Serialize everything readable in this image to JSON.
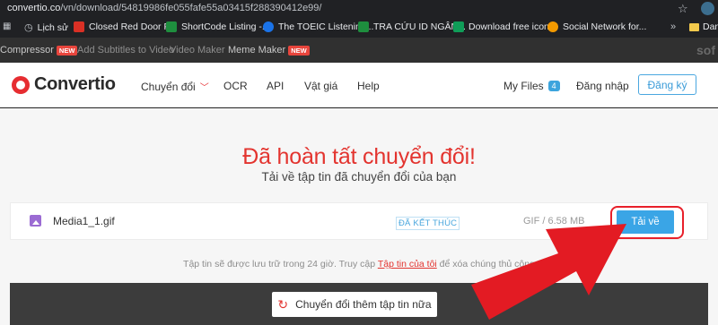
{
  "browser": {
    "url_host": "convertio.co",
    "url_path": "/vn/download/54819986fe055fafe55a03415f288390412e99/",
    "bookmarks": [
      {
        "label": "",
        "icon": "apps-icon"
      },
      {
        "label": "Lịch sử",
        "icon": "history-icon"
      },
      {
        "label": "Closed Red Door P...",
        "icon": "pinterest-icon"
      },
      {
        "label": "ShortCode Listing -...",
        "icon": "sheets-icon"
      },
      {
        "label": "The TOEIC Listening...",
        "icon": "loading-icon"
      },
      {
        "label": "TRA CỨU ID NGÂN...",
        "icon": "sheets-icon"
      },
      {
        "label": "Download free icon...",
        "icon": "sheets-icon"
      },
      {
        "label": "Social Network for...",
        "icon": "site-icon"
      }
    ],
    "more": "»",
    "other_bookmarks": "Dan"
  },
  "toolstrip": {
    "items": [
      "Compressor",
      "Add Subtitles to Video",
      "Video Maker",
      "Meme Maker"
    ],
    "new_badge": "NEW",
    "logo": "sof"
  },
  "nav": {
    "brand": "Convertio",
    "links": [
      "Chuyển đổi",
      "OCR",
      "API",
      "Vật giá",
      "Help"
    ],
    "my_files": "My Files",
    "my_files_count": "4",
    "login": "Đăng nhập",
    "signup": "Đăng ký"
  },
  "main": {
    "title": "Đã hoàn tất chuyển đổi!",
    "subtitle": "Tải về tập tin đã chuyển đổi của bạn",
    "file": {
      "name": "Media1_1.gif",
      "status": "ĐÃ KẾT THÚC",
      "meta": "GIF / 6.58 MB",
      "download": "Tải về"
    },
    "notice_before": "Tập tin sẽ được lưu trữ trong 24 giờ. Truy cập ",
    "notice_link": "Tập tin của tôi",
    "notice_after": " để xóa chúng thủ công",
    "convert_more": "Chuyển đổi thêm tập tin nữa"
  },
  "colors": {
    "accent_red": "#e3342f",
    "accent_blue": "#3aa5e6"
  }
}
